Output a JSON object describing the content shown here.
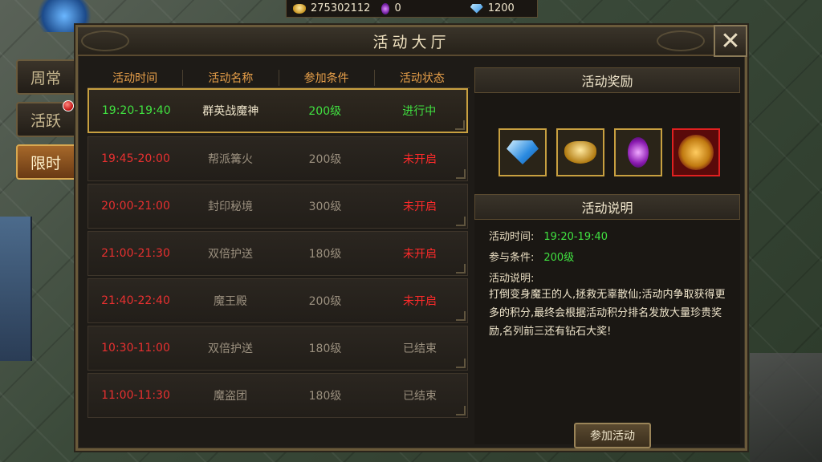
{
  "currency": {
    "gold": "275302112",
    "purple": "0",
    "diamond": "1200"
  },
  "side_tabs": [
    {
      "label": "周常",
      "active": false
    },
    {
      "label": "活跃",
      "active": false,
      "badge": true
    },
    {
      "label": "限时",
      "active": true
    }
  ],
  "window": {
    "title": "活动大厅",
    "close": "✕"
  },
  "list": {
    "headers": [
      "活动时间",
      "活动名称",
      "参加条件",
      "活动状态"
    ],
    "rows": [
      {
        "time": "19:20-19:40",
        "name": "群英战魔神",
        "cond": "200级",
        "status": "进行中",
        "state": "going"
      },
      {
        "time": "19:45-20:00",
        "name": "帮派篝火",
        "cond": "200级",
        "status": "未开启",
        "state": "open"
      },
      {
        "time": "20:00-21:00",
        "name": "封印秘境",
        "cond": "300级",
        "status": "未开启",
        "state": "open"
      },
      {
        "time": "21:00-21:30",
        "name": "双倍护送",
        "cond": "180级",
        "status": "未开启",
        "state": "open"
      },
      {
        "time": "21:40-22:40",
        "name": "魔王殿",
        "cond": "200级",
        "status": "未开启",
        "state": "open"
      },
      {
        "time": "10:30-11:00",
        "name": "双倍护送",
        "cond": "180级",
        "status": "已结束",
        "state": "ended"
      },
      {
        "time": "11:00-11:30",
        "name": "魔盗团",
        "cond": "180级",
        "status": "已结束",
        "state": "ended"
      }
    ]
  },
  "rewards": {
    "title": "活动奖励",
    "items": [
      "diamond-icon",
      "gold-ingot-icon",
      "purple-orb-icon",
      "golden-mask-icon"
    ]
  },
  "info": {
    "title": "活动说明",
    "time_label": "活动时间:",
    "time_value": "19:20-19:40",
    "cond_label": "参与条件:",
    "cond_value": "200级",
    "desc_label": "活动说明:",
    "desc_text": "打倒变身魔王的人,拯救无辜散仙;活动内争取获得更多的积分,最终会根据活动积分排名发放大量珍贵奖励,名列前三还有钻石大奖!"
  },
  "join_button": "参加活动"
}
